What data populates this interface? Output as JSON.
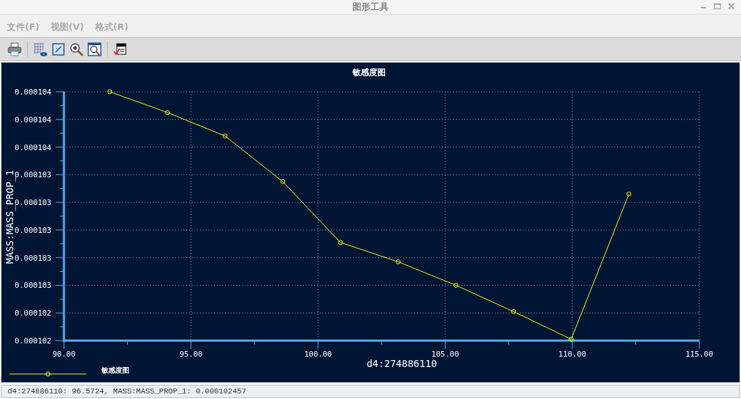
{
  "window": {
    "title": "图形工具"
  },
  "menu": [
    {
      "label": "文件(F)"
    },
    {
      "label": "视图(V)"
    },
    {
      "label": "格式(R)"
    }
  ],
  "toolbar": [
    {
      "kind": "print"
    },
    {
      "kind": "grid"
    },
    {
      "kind": "edit"
    },
    {
      "kind": "zoom-in"
    },
    {
      "kind": "zoom-fit"
    },
    {
      "kind": "properties"
    }
  ],
  "chart": {
    "chart_data": {
      "type": "line",
      "title": "敏感度图",
      "xlabel": "d4:274886110",
      "ylabel": "MASS:MASS_PROP_1",
      "x": [
        91.8,
        94.07,
        96.34,
        98.61,
        100.88,
        103.15,
        105.42,
        107.69,
        109.96,
        112.23
      ],
      "grid": true,
      "series": [
        {
          "name": "敏感度图",
          "color": "#ffff00",
          "marker": "circle",
          "values": [
            0.000104,
            0.00010385,
            0.00010368,
            0.00010335,
            0.00010291,
            0.00010277,
            0.0001026,
            0.00010241,
            0.00010221,
            0.00010326
          ]
        }
      ],
      "xlim": [
        90,
        115
      ],
      "ylim": [
        0.0001022,
        0.000104
      ],
      "xticks": [
        {
          "value": 90,
          "label": "90.00"
        },
        {
          "value": 95,
          "label": "95.00"
        },
        {
          "value": 100,
          "label": "100.00"
        },
        {
          "value": 105,
          "label": "105.00"
        },
        {
          "value": 110,
          "label": "110.00"
        },
        {
          "value": 115,
          "label": "115.00"
        }
      ],
      "yticks": [
        {
          "value": 0.0001022,
          "label": "0.000102"
        },
        {
          "value": 0.0001024,
          "label": "0.000102"
        },
        {
          "value": 0.0001026,
          "label": "0.000103"
        },
        {
          "value": 0.0001028,
          "label": "0.000103"
        },
        {
          "value": 0.000103,
          "label": "0.000103"
        },
        {
          "value": 0.0001032,
          "label": "0.000103"
        },
        {
          "value": 0.0001034,
          "label": "0.000103"
        },
        {
          "value": 0.0001036,
          "label": "0.000104"
        },
        {
          "value": 0.0001038,
          "label": "0.000104"
        },
        {
          "value": 0.000104,
          "label": "0.000104"
        }
      ]
    }
  },
  "status_bar": "d4:274886110: 96.5724, MASS:MASS_PROP_1: 0.000102457"
}
